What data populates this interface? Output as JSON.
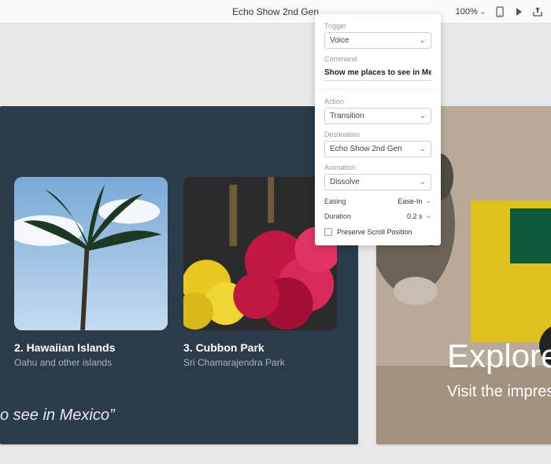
{
  "toolbar": {
    "title": "Echo Show 2nd Gen",
    "zoom": "100%"
  },
  "panel": {
    "trigger_label": "Trigger",
    "trigger_value": "Voice",
    "command_label": "Command",
    "command_value": "Show me places to see in Mexico",
    "action_label": "Action",
    "action_value": "Transition",
    "destination_label": "Destination",
    "destination_value": "Echo Show 2nd Gen",
    "animation_label": "Animation",
    "animation_value": "Dissolve",
    "easing_label": "Easing",
    "easing_value": "Ease-In",
    "duration_label": "Duration",
    "duration_value": "0.2 s",
    "preserve_label": "Preserve Scroll Position"
  },
  "cards": [
    {
      "title": "2. Hawaiian Islands",
      "subtitle": "Oahu and other  islands"
    },
    {
      "title": "3. Cubbon Park",
      "subtitle": "Sri Chamarajendra Park"
    }
  ],
  "quote": "o see in Mexico”",
  "right": {
    "headline": "Explore",
    "subline": "Visit the impres"
  }
}
